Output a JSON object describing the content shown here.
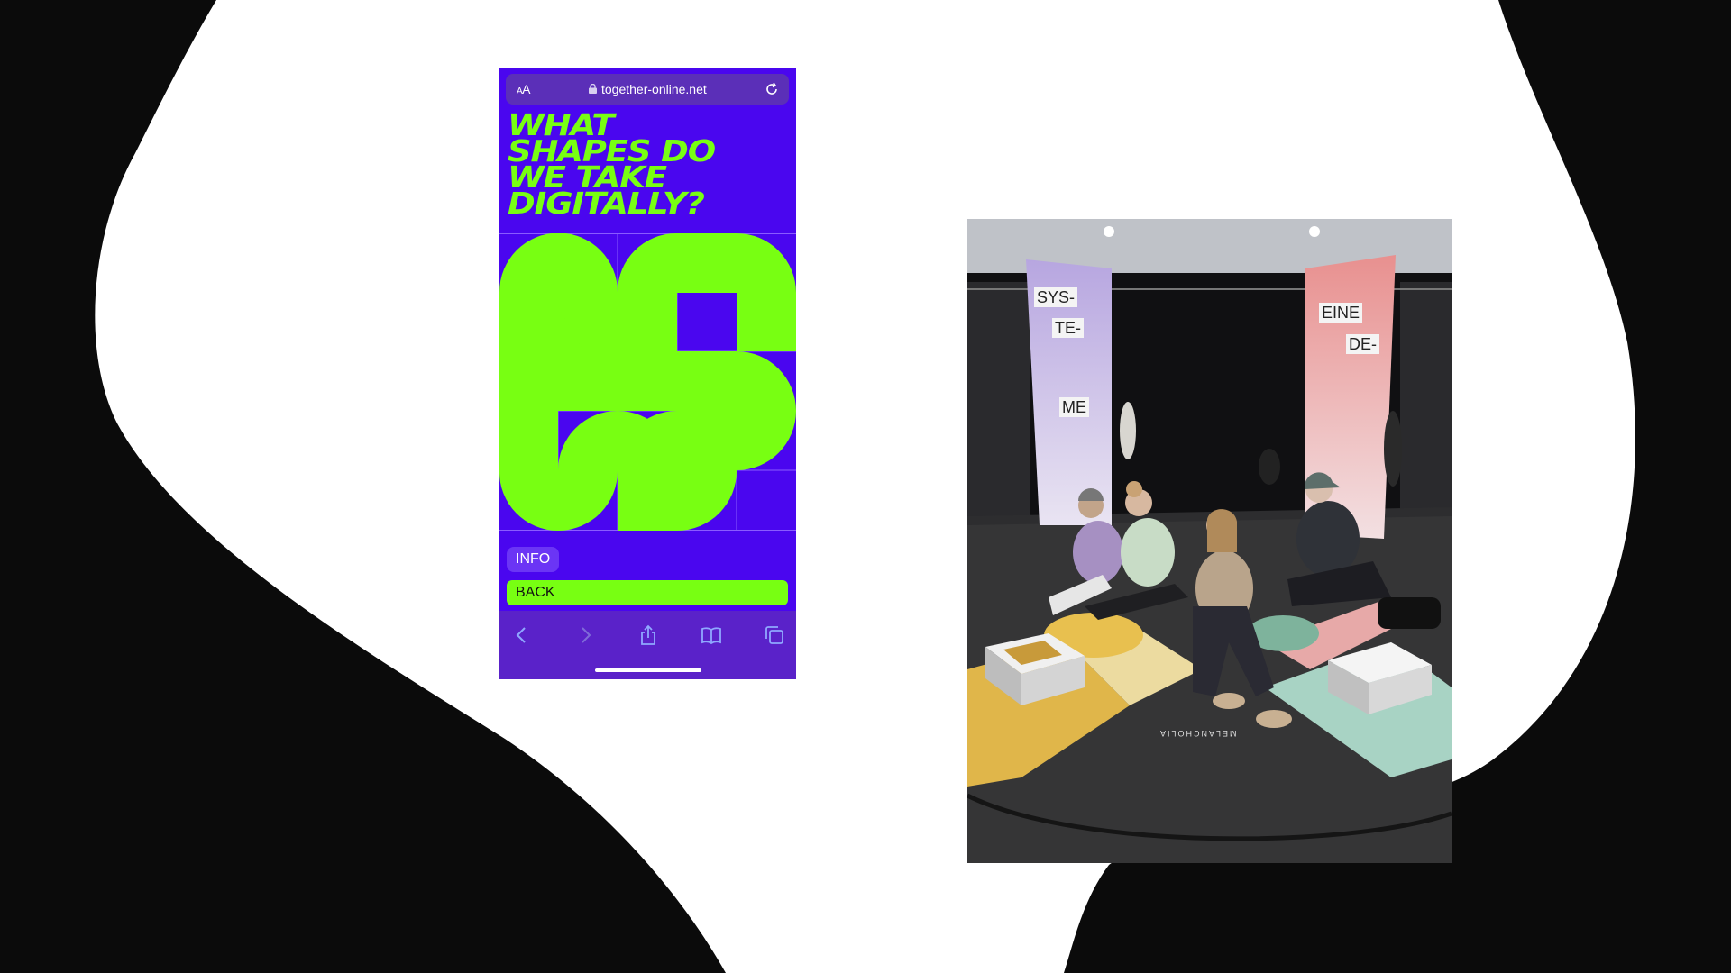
{
  "browser": {
    "aa_label_small": "A",
    "aa_label_large": "A",
    "url": "together-online.net"
  },
  "page": {
    "headline_lines": [
      "WHAT",
      "SHAPES DO",
      "WE TAKE",
      "DIGITALLY?"
    ],
    "info_label": "INFO",
    "back_label": "BACK"
  },
  "toolbar": {
    "icons": [
      "back-icon",
      "forward-icon",
      "share-icon",
      "bookmarks-icon",
      "tabs-icon"
    ]
  },
  "photo": {
    "banner_left_words": [
      "SYS-",
      "TE-",
      "ME"
    ],
    "banner_right_words": [
      "EINE",
      "DE-"
    ],
    "floor_text": "MELANCHOLIA"
  },
  "colors": {
    "phone_background": "#4a06ef",
    "accent_green": "#78ff12",
    "page_background": "#0b0b0b",
    "blob_white": "#ffffff"
  }
}
